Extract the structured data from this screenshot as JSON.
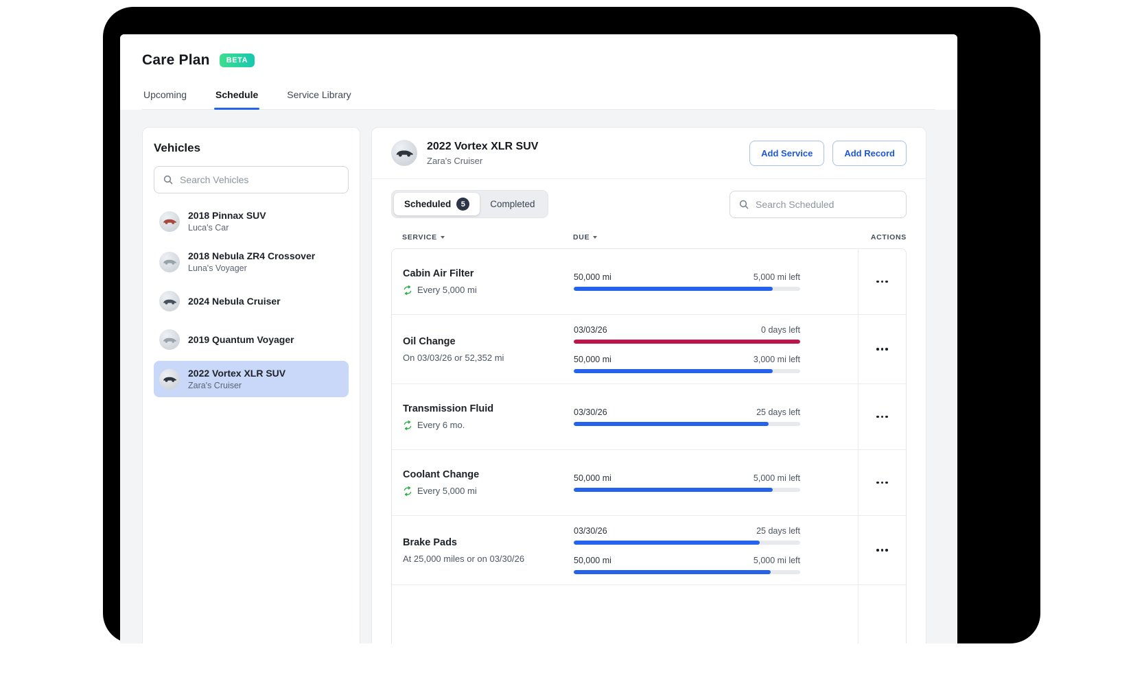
{
  "app": {
    "title": "Care Plan",
    "beta_badge": "BETA",
    "tabs": [
      {
        "label": "Upcoming",
        "active": false
      },
      {
        "label": "Schedule",
        "active": true
      },
      {
        "label": "Service Library",
        "active": false
      }
    ]
  },
  "sidebar": {
    "title": "Vehicles",
    "search_placeholder": "Search Vehicles",
    "vehicles": [
      {
        "name": "2018 Pinnax SUV",
        "subtitle": "Luca's Car",
        "selected": false,
        "avatar_color": "#a8473d"
      },
      {
        "name": "2018 Nebula ZR4 Crossover",
        "subtitle": "Luna's Voyager",
        "selected": false,
        "avatar_color": "#99a1a9"
      },
      {
        "name": "2024 Nebula Cruiser",
        "subtitle": "",
        "selected": false,
        "avatar_color": "#47515c"
      },
      {
        "name": "2019 Quantum Voyager",
        "subtitle": "",
        "selected": false,
        "avatar_color": "#99a1a9"
      },
      {
        "name": "2022 Vortex XLR SUV",
        "subtitle": "Zara's Cruiser",
        "selected": true,
        "avatar_color": "#2f353c"
      }
    ]
  },
  "detail": {
    "vehicle_name": "2022 Vortex XLR SUV",
    "vehicle_subtitle": "Zara's Cruiser",
    "avatar_color": "#2f353c",
    "buttons": {
      "add_service": "Add Service",
      "add_record": "Add Record"
    },
    "view_tabs": {
      "scheduled": "Scheduled",
      "scheduled_count": "5",
      "completed": "Completed"
    },
    "search_placeholder": "Search Scheduled",
    "table": {
      "columns": {
        "service": "SERVICE",
        "due": "DUE",
        "actions": "ACTIONS"
      },
      "rows": [
        {
          "service": "Cabin Air Filter",
          "detail": "Every 5,000 mi",
          "recurring": true,
          "bars": [
            {
              "left": "50,000 mi",
              "right": "5,000 mi left",
              "percent": 88,
              "color": "blue"
            }
          ]
        },
        {
          "service": "Oil Change",
          "detail": "On 03/03/26 or 52,352 mi",
          "recurring": false,
          "bars": [
            {
              "left": "03/03/26",
              "right": "0 days left",
              "percent": 100,
              "color": "red"
            },
            {
              "left": "50,000 mi",
              "right": "3,000 mi left",
              "percent": 88,
              "color": "blue"
            }
          ]
        },
        {
          "service": "Transmission Fluid",
          "detail": "Every 6 mo.",
          "recurring": true,
          "bars": [
            {
              "left": "03/30/26",
              "right": "25 days left",
              "percent": 86,
              "color": "blue"
            }
          ]
        },
        {
          "service": "Coolant Change",
          "detail": "Every 5,000 mi",
          "recurring": true,
          "bars": [
            {
              "left": "50,000 mi",
              "right": "5,000 mi left",
              "percent": 88,
              "color": "blue"
            }
          ]
        },
        {
          "service": "Brake Pads",
          "detail": "At 25,000 miles or on 03/30/26",
          "recurring": false,
          "bars": [
            {
              "left": "03/30/26",
              "right": "25 days left",
              "percent": 82,
              "color": "blue"
            },
            {
              "left": "50,000 mi",
              "right": "5,000 mi left",
              "percent": 87,
              "color": "blue"
            }
          ]
        }
      ]
    }
  },
  "colors": {
    "accent_blue": "#2563eb",
    "progress_red": "#c0154a",
    "repeat_green": "#2fae4a",
    "beta_gradient_start": "#3edd8d",
    "beta_gradient_end": "#17c8b0",
    "selected_vehicle_bg": "#c9d8f8",
    "count_badge_bg": "#2b3546"
  }
}
